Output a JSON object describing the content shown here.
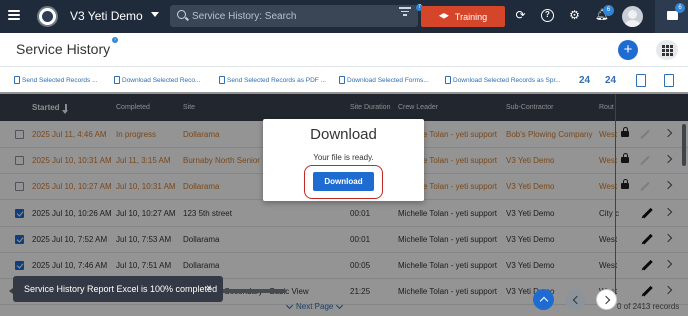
{
  "topbar": {
    "app_title": "V3 Yeti Demo",
    "search_placeholder": "Service History: Search",
    "filter_badge": "7",
    "training_label": "Training",
    "notifications_badge": "6",
    "chat_badge": "6"
  },
  "page": {
    "title": "Service History",
    "title_badge": "?"
  },
  "toolbar": {
    "items": [
      "Send Selected Records ...",
      "Download Selected Reco...",
      "Send Selected Records as PDF ...",
      "Download Selected Forms...",
      "Download Selected Records as Spr..."
    ],
    "icon_24_a": "24",
    "icon_24_b": "24"
  },
  "table": {
    "columns": [
      "Started",
      "Completed",
      "Site",
      "Site Duration",
      "Crew Leader",
      "Sub-Contractor",
      "Rout"
    ],
    "rows": [
      {
        "state": "inprog",
        "checked": false,
        "started": "2025 Jul 11, 4:46 AM",
        "completed": "In progress",
        "site": "Dollarama",
        "duration": "",
        "crew": "Michelle Tolan - yeti support",
        "sub": "Bob's Plowing Company",
        "route": "West",
        "action": "lock"
      },
      {
        "state": "inprog",
        "checked": false,
        "started": "2025 Jul 10, 10:31 AM",
        "completed": "Jul 11, 3:15 AM",
        "site": "Burnaby North Senior",
        "duration": "",
        "crew": "Michelle Tolan - yeti support",
        "sub": "V3 Yeti Demo",
        "route": "West",
        "action": "lock"
      },
      {
        "state": "inprog",
        "checked": false,
        "started": "2025 Jul 10, 10:27 AM",
        "completed": "Jul 10, 10:31 AM",
        "site": "Dollarama",
        "duration": "",
        "crew": "Michelle Tolan - yeti support",
        "sub": "V3 Yeti Demo",
        "route": "West",
        "action": "lock"
      },
      {
        "state": "done",
        "checked": true,
        "started": "2025 Jul 10, 10:26 AM",
        "completed": "Jul 10, 10:27 AM",
        "site": "123 5th street",
        "duration": "00:01",
        "crew": "Michelle Tolan - yeti support",
        "sub": "V3 Yeti Demo",
        "route": "City c",
        "action": "edit"
      },
      {
        "state": "done",
        "checked": true,
        "started": "2025 Jul 10, 7:52 AM",
        "completed": "Jul 10, 7:53 AM",
        "site": "Dollarama",
        "duration": "00:01",
        "crew": "Michelle Tolan - yeti support",
        "sub": "V3 Yeti Demo",
        "route": "West",
        "action": "edit"
      },
      {
        "state": "done",
        "checked": true,
        "started": "2025 Jul 10, 7:46 AM",
        "completed": "Jul 10, 7:51 AM",
        "site": "Dollarama",
        "duration": "00:05",
        "crew": "Michelle Tolan - yeti support",
        "sub": "V3 Yeti Demo",
        "route": "West",
        "action": "edit"
      },
      {
        "state": "done",
        "checked": true,
        "started": "",
        "completed": "",
        "site": "orth Senior Secondary - Basic View",
        "duration": "21:25",
        "crew": "Michelle Tolan - yeti support",
        "sub": "V3 Yeti Demo",
        "route": "West",
        "action": "edit"
      }
    ]
  },
  "modal": {
    "title": "Download",
    "message": "Your file is ready.",
    "button": "Download"
  },
  "footer": {
    "next_page": "Next Page",
    "record_count": "0 of 2413 records"
  },
  "toast": {
    "message": "Service History Report Excel is 100% completed",
    "close": "×"
  },
  "colors": {
    "topbar": "#1f2a3a",
    "accent": "#1e6cd2",
    "training": "#d5452a",
    "in_progress": "#d47c2d",
    "highlight_ring": "#c62828"
  }
}
